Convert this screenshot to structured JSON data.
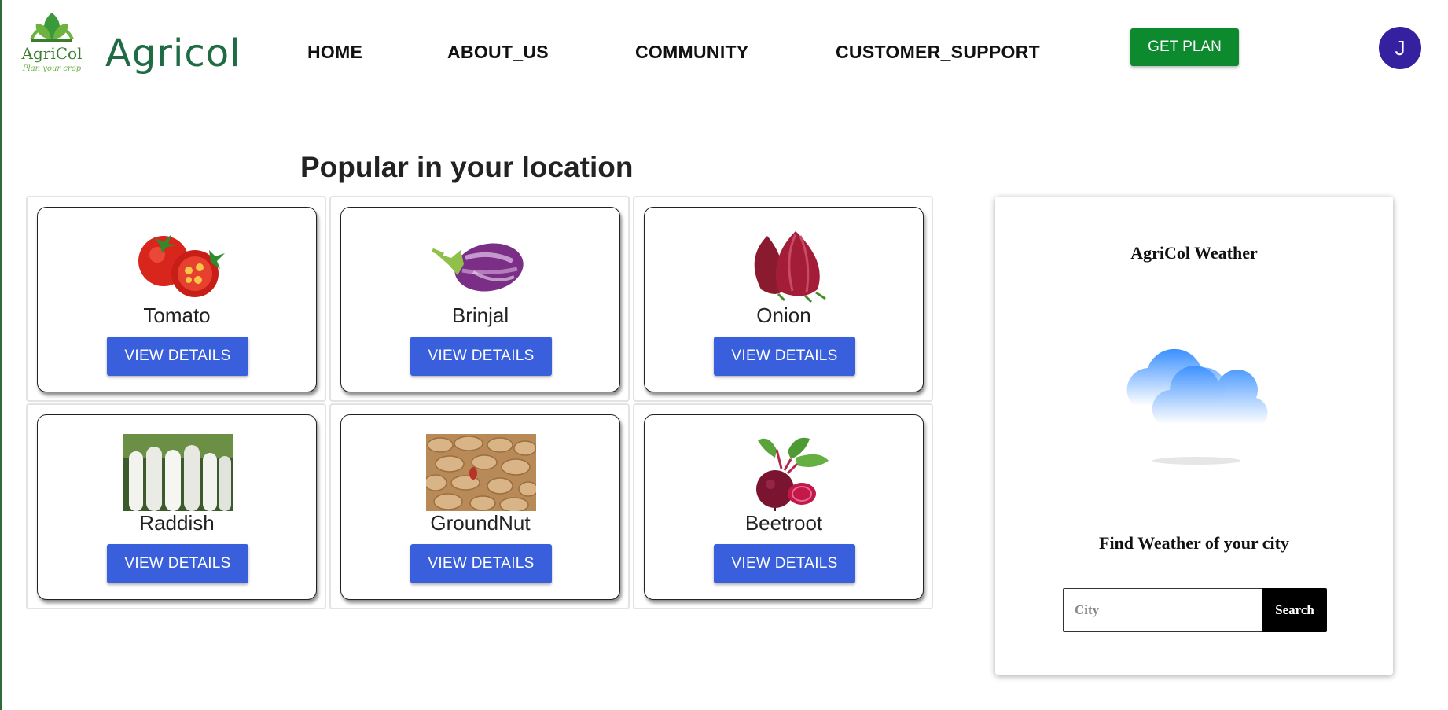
{
  "header": {
    "logo_text": "AgriCol",
    "logo_tagline": "Plan your crop",
    "brand": "Agricol",
    "nav": [
      "HOME",
      "ABOUT_US",
      "COMMUNITY",
      "CUSTOMER_SUPPORT"
    ],
    "cta": "GET PLAN",
    "avatar_initial": "J"
  },
  "popular": {
    "title": "Popular in your location",
    "button_label": "VIEW DETAILS",
    "crops": [
      {
        "name": "Tomato",
        "icon": "tomato-image"
      },
      {
        "name": "Brinjal",
        "icon": "brinjal-image"
      },
      {
        "name": "Onion",
        "icon": "onion-image"
      },
      {
        "name": "Raddish",
        "icon": "raddish-image"
      },
      {
        "name": "GroundNut",
        "icon": "groundnut-image"
      },
      {
        "name": "Beetroot",
        "icon": "beetroot-image"
      }
    ]
  },
  "weather": {
    "title": "AgriCol Weather",
    "icon": "cloud-icon",
    "subtitle": "Find Weather of your city",
    "input_placeholder": "City",
    "search_label": "Search"
  },
  "colors": {
    "brand_green": "#1f6b44",
    "cta_green": "#0d8a2e",
    "button_blue": "#3a5fdc",
    "avatar_purple": "#3520a0"
  }
}
